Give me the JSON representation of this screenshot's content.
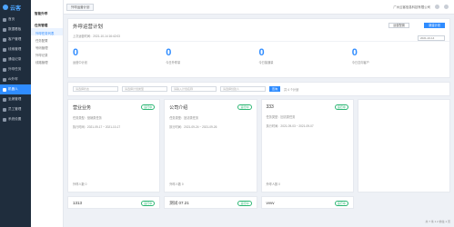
{
  "brand": "云客",
  "nav": {
    "items": [
      {
        "label": "首页"
      },
      {
        "label": "数据看板"
      },
      {
        "label": "客户管理"
      },
      {
        "label": "线索管理"
      },
      {
        "label": "通话记录"
      },
      {
        "label": "外呼任务"
      },
      {
        "label": "AI外呼"
      },
      {
        "label": "机器人"
      },
      {
        "label": "坐席管理"
      },
      {
        "label": "员工管理"
      },
      {
        "label": "系统设置"
      }
    ]
  },
  "submenu": {
    "sec1": "智能外呼",
    "sec2": "任务管理",
    "items": [
      "外呼任务列表",
      "任务配置",
      "号码管理",
      "外呼记录",
      "线路管理"
    ]
  },
  "topbar": {
    "tab": "外呼运营计划",
    "user": "广州云客信息科技有限公司"
  },
  "header": {
    "title": "外呼运营计划",
    "meta": "上次运营时间：2021-10-14 16:42:03",
    "btn1": "运营配置",
    "btn2": "新建计划"
  },
  "stats": [
    {
      "value": "0",
      "label": "运营中计划"
    },
    {
      "value": "0",
      "label": "今日外呼量"
    },
    {
      "value": "0",
      "label": "今日接通量"
    },
    {
      "value": "0",
      "label": "今日意向客户"
    }
  ],
  "date_range": "2021-10-14",
  "filter": {
    "f1": "请选择状态",
    "f2": "请选择计划类型",
    "f3": "请输入计划名称",
    "f4": "请选择创建人",
    "query": "查询",
    "count": "共 4 个计划"
  },
  "plans": [
    {
      "title": "营业业务",
      "status": "运行中",
      "l1": "任务类型：营销类任务",
      "l2": "执行时间：2021-09-17 ~ 2021-10-17",
      "bot": "外呼人数 0"
    },
    {
      "title": "公司介绍",
      "status": "运行中",
      "l1": "任务类型：回访类任务",
      "l2": "执行时间：2021-09-24 ~ 2021-09-26",
      "bot": "外呼人数 0"
    },
    {
      "title": "333",
      "status": "运行中",
      "l1": "任务类型：回访类任务",
      "l2": "执行时间：2021-09-03 ~ 2021-09-07",
      "bot": "外呼人数 0"
    },
    {
      "title": "",
      "status": "",
      "l1": "",
      "l2": "",
      "bot": ""
    }
  ],
  "mini": [
    {
      "title": "1313",
      "status": "运行中"
    },
    {
      "title": "测试 07.21",
      "status": "运行中"
    },
    {
      "title": "vvvv",
      "status": "运行中"
    },
    {
      "title": "",
      "status": ""
    }
  ],
  "pager": "共 7 条  1  2  前往  1  页",
  "colors": {
    "accent": "#2f8cff",
    "sidebar": "#1f2d3d",
    "success": "#2bb673"
  }
}
